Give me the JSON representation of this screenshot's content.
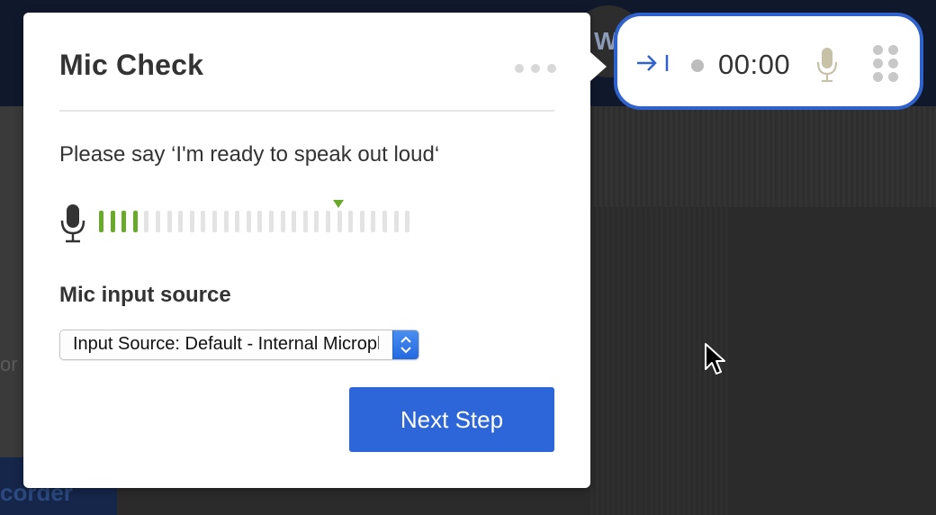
{
  "background": {
    "avatar_letter": "W",
    "left_text": "or",
    "bottom_label": "corder"
  },
  "mic_check": {
    "title": "Mic Check",
    "instruction": "Please say ‘I'm ready to speak out loud‘",
    "level": {
      "active_bars": 4,
      "total_bars": 28,
      "threshold_bar": 21
    },
    "input_source_label": "Mic input source",
    "input_source_value": "Input Source: Default - Internal Microphone",
    "next_button_label": "Next Step"
  },
  "recorder": {
    "timer": "00:00"
  },
  "icons": {
    "panel_menu": "more-horizontal-icon",
    "meter_mic": "microphone-icon",
    "recorder_collapse": "collapse-right-icon",
    "recorder_mic": "microphone-icon",
    "recorder_grip": "grip-icon",
    "cursor": "mouse-pointer-icon"
  },
  "colors": {
    "accent_blue": "#2d66d8",
    "level_active": "#6aaa2a",
    "level_inactive": "#e3e3e3",
    "recorder_border": "#2f62cc"
  }
}
